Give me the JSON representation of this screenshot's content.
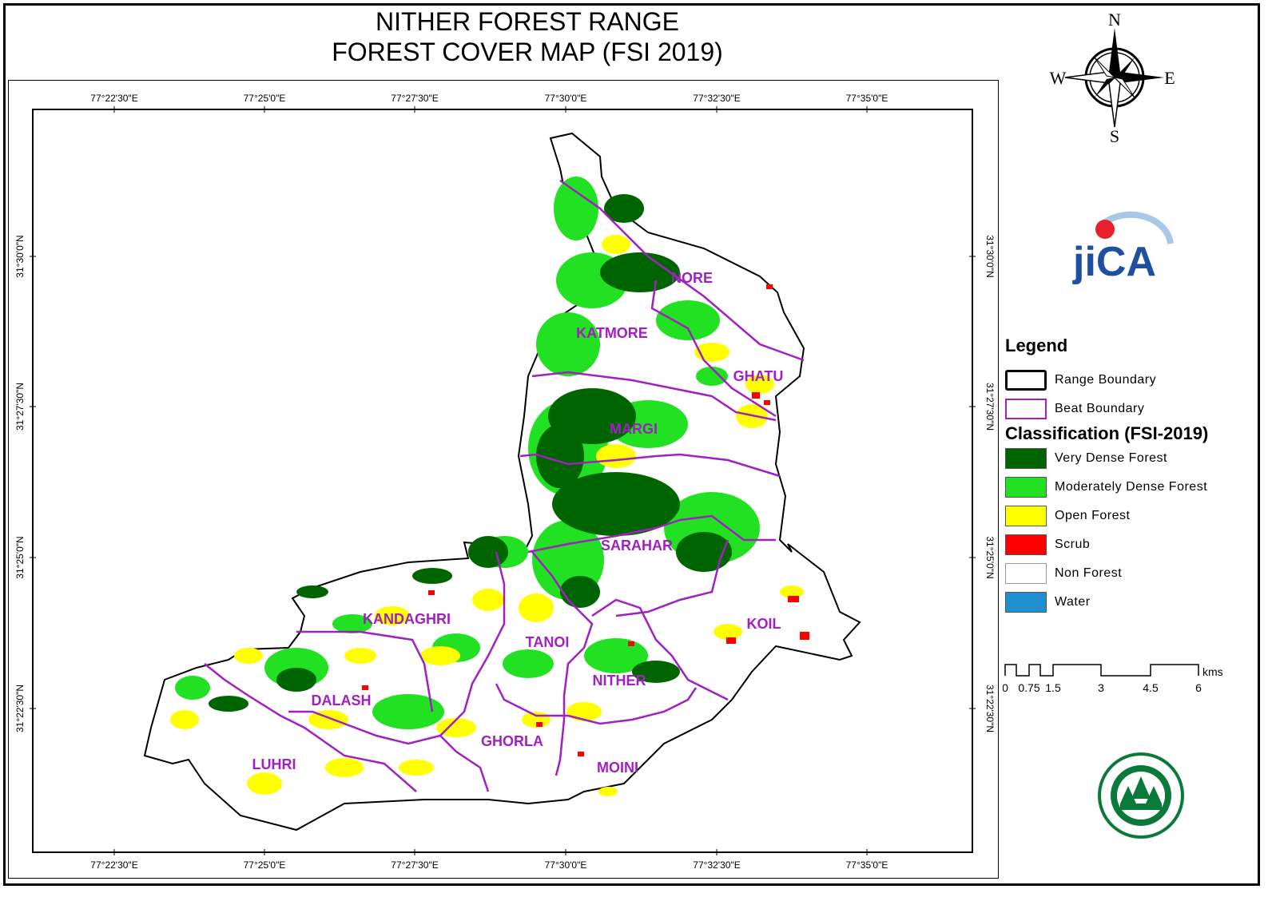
{
  "title": {
    "line1": "NITHER FOREST RANGE",
    "line2": "FOREST COVER MAP (FSI 2019)"
  },
  "coords": {
    "lon_ticks": [
      "77°22'30\"E",
      "77°25'0\"E",
      "77°27'30\"E",
      "77°30'0\"E",
      "77°32'30\"E",
      "77°35'0\"E"
    ],
    "lat_ticks": [
      "31°30'0\"N",
      "31°27'30\"N",
      "31°25'0\"N",
      "31°22'30\"N"
    ]
  },
  "beats": [
    "NORE",
    "KATMORE",
    "GHATU",
    "MARGI",
    "SARAHAR",
    "KANDAGHRI",
    "TANOI",
    "KOIL",
    "NITHER",
    "DALASH",
    "GHORLA",
    "LUHRI",
    "MOINI"
  ],
  "compass": {
    "n": "N",
    "s": "S",
    "e": "E",
    "w": "W"
  },
  "logo": {
    "text": "jiCA"
  },
  "legend": {
    "title": "Legend",
    "boundaries": [
      {
        "label": "Range Boundary",
        "color": "#000000"
      },
      {
        "label": "Beat Boundary",
        "color": "#a020c0"
      }
    ],
    "classification_title": "Classification (FSI-2019)",
    "classes": [
      {
        "label": "Very Dense Forest",
        "color": "#006400"
      },
      {
        "label": "Moderately Dense Forest",
        "color": "#22e022"
      },
      {
        "label": "Open Forest",
        "color": "#ffff00"
      },
      {
        "label": "Scrub",
        "color": "#ff0000"
      },
      {
        "label": "Non Forest",
        "color": "#ffffff"
      },
      {
        "label": "Water",
        "color": "#1e90d0"
      }
    ]
  },
  "scale": {
    "unit": "kms",
    "ticks": [
      "0",
      "0.75",
      "1.5",
      "3",
      "4.5",
      "6"
    ]
  }
}
